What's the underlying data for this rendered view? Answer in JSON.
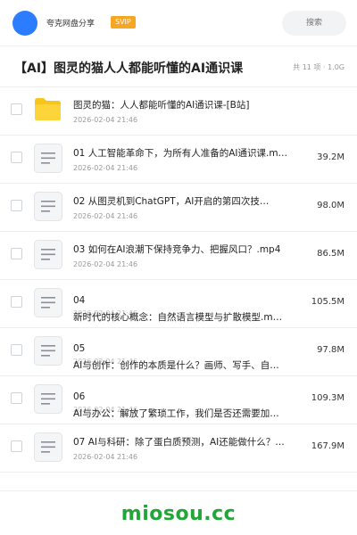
{
  "header": {
    "share_name": "夸克网盘分享",
    "badge": "SVIP",
    "search_placeholder": "搜索",
    "avatar_color": "#2b7cff",
    "badge_color": "#f5a623"
  },
  "title_bar": {
    "title": "【AI】图灵的猫人人都能听懂的AI通识课",
    "meta": "共 11 项 · 1.0G"
  },
  "files": [
    {
      "type": "folder",
      "name": "图灵的猫：人人都能听懂的AI通识课-[B站]",
      "date": "2026-02-04 21:46",
      "size": ""
    },
    {
      "type": "doc",
      "name": "01 人工智能革命下，为所有人准备的AI通识课.m…",
      "date": "2026-02-04 21:46",
      "size": "39.2M"
    },
    {
      "type": "doc",
      "name": "02 从图灵机到ChatGPT，AI开启的第四次技…",
      "date": "2026-02-04 21:46",
      "size": "98.0M"
    },
    {
      "type": "doc",
      "name": "03 如何在AI浪潮下保持竞争力、把握风口？.mp4",
      "date": "2026-02-04 21:46",
      "size": "86.5M"
    },
    {
      "type": "doc",
      "num": "04",
      "name": "新时代的核心概念：自然语言模型与扩散模型.m…",
      "date": "2026-02-04 21:46",
      "size": "105.5M"
    },
    {
      "type": "doc",
      "num": "05",
      "name": "AI与创作：创作的本质是什么？画师、写手、自…",
      "date": "2026-02-04 21:46",
      "size": "97.8M"
    },
    {
      "type": "doc",
      "num": "06",
      "name": "AI与办公：解放了繁琐工作，我们是否还需要加…",
      "date": "2026-02-04 21:46",
      "size": "109.3M"
    },
    {
      "type": "doc",
      "name": "07 AI与科研：除了蛋白质预测，AI还能做什么？…",
      "date": "2026-02-04 21:46",
      "size": "167.9M"
    }
  ],
  "watermark": "miosou.cc",
  "icons": {
    "folder": "folder-icon",
    "doc": "document-icon",
    "checkbox": "checkbox-icon"
  }
}
